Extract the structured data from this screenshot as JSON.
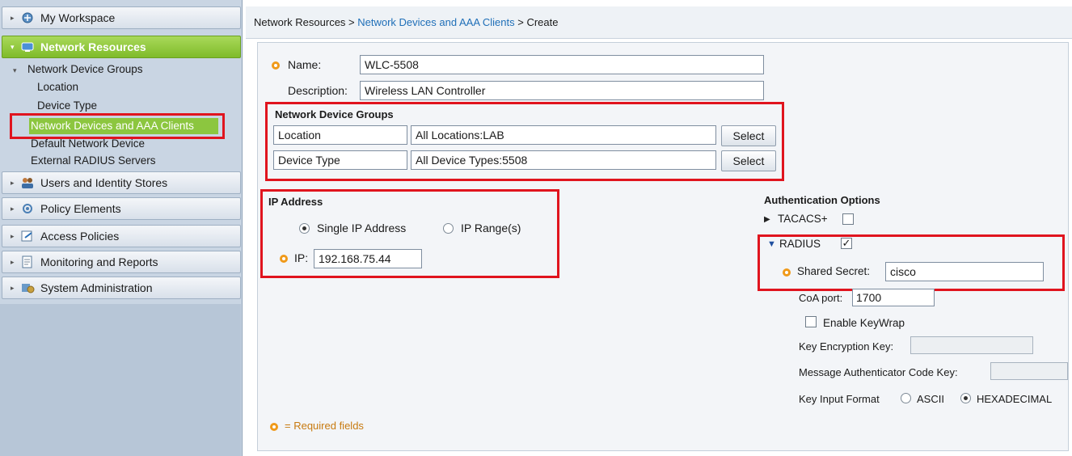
{
  "sidebar": {
    "my_workspace": "My Workspace",
    "network_resources": "Network Resources",
    "network_device_groups": "Network Device Groups",
    "location": "Location",
    "device_type": "Device Type",
    "network_devices_aaa": "Network Devices and AAA Clients",
    "default_network_device": "Default Network Device",
    "external_radius": "External RADIUS Servers",
    "users_identity": "Users and Identity Stores",
    "policy_elements": "Policy Elements",
    "access_policies": "Access Policies",
    "monitoring_reports": "Monitoring and Reports",
    "system_admin": "System Administration"
  },
  "breadcrumb": {
    "part1": "Network Resources > ",
    "part2": "Network Devices and AAA Clients",
    "part3": " > Create"
  },
  "form": {
    "name_label": "Name:",
    "name_value": "WLC-5508",
    "description_label": "Description:",
    "description_value": "Wireless LAN Controller",
    "ndg_title": "Network Device Groups",
    "location_label": "Location",
    "location_value": "All Locations:LAB",
    "device_type_label": "Device Type",
    "device_type_value": "All Device Types:5508",
    "select_label": "Select",
    "ip_title": "IP Address",
    "single_ip": "Single IP Address",
    "ip_range": "IP Range(s)",
    "ip_label": "IP:",
    "ip_value": "192.168.75.44",
    "required_fields": "= Required fields"
  },
  "auth": {
    "title": "Authentication Options",
    "tacacs": "TACACS+",
    "radius": "RADIUS",
    "shared_secret_label": "Shared Secret:",
    "shared_secret_value": "cisco",
    "coa_port_label": "CoA port:",
    "coa_port_value": "1700",
    "enable_keywrap": "Enable KeyWrap",
    "key_encryption_key": "Key Encryption Key:",
    "message_auth_key": "Message Authenticator Code Key:",
    "key_input_format": "Key Input Format",
    "ascii": "ASCII",
    "hexadecimal": "HEXADECIMAL"
  },
  "state": {
    "selected_ip_mode": "Single IP Address",
    "tacacs_checked": false,
    "radius_checked": true,
    "keywrap_checked": false,
    "key_format_selected": "HEXADECIMAL"
  },
  "colors": {
    "highlight_box": "#e0141e",
    "active_nav": "#8cc63f",
    "required_marker": "#f09a1a",
    "link": "#1f6fb8"
  }
}
